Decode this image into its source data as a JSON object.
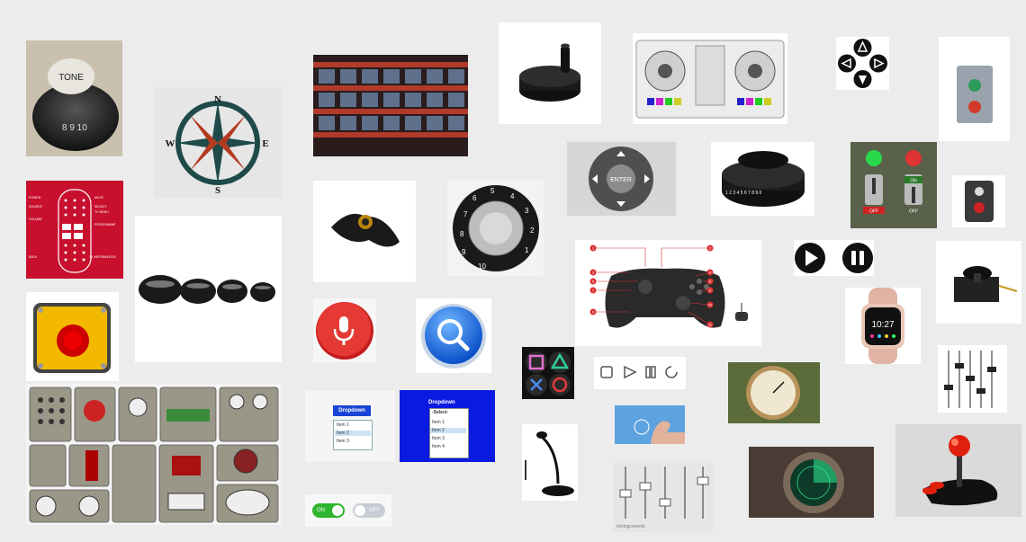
{
  "tone_knob": {
    "label": "TONE"
  },
  "compass": {
    "n": "N",
    "e": "E",
    "s": "S",
    "w": "W"
  },
  "remote_labels": {
    "left": [
      "POWER",
      "SOURCE",
      "VOLUME",
      "BACK"
    ],
    "right": [
      "MUTE",
      "SELECT",
      "TV MENU",
      "PROGRAMME",
      "TV INFORMATION"
    ]
  },
  "dpad": {
    "center_label": "ENTER"
  },
  "toggle_switches": {
    "left_label": "OFF",
    "right_label": "ON",
    "right_bottom": "OFF"
  },
  "controller_callouts": {
    "left": [
      "1",
      "3",
      "5",
      "7",
      "9"
    ],
    "right": [
      "2",
      "4",
      "6",
      "8",
      "10",
      "11"
    ]
  },
  "dropdown_light": {
    "title": "Dropdown",
    "items": [
      "Item 1",
      "Item 2",
      "Item 3"
    ]
  },
  "dropdown_dark": {
    "title": "Dropdown",
    "select": "-Select-",
    "items": [
      "Item 1",
      "Item 2",
      "Item 3",
      "Item 4"
    ]
  },
  "toggles": {
    "on_label": "ON",
    "off_label": "OFF"
  },
  "smartwatch": {
    "time": "10:27"
  },
  "faders": {
    "brand": "mixingconsole"
  }
}
